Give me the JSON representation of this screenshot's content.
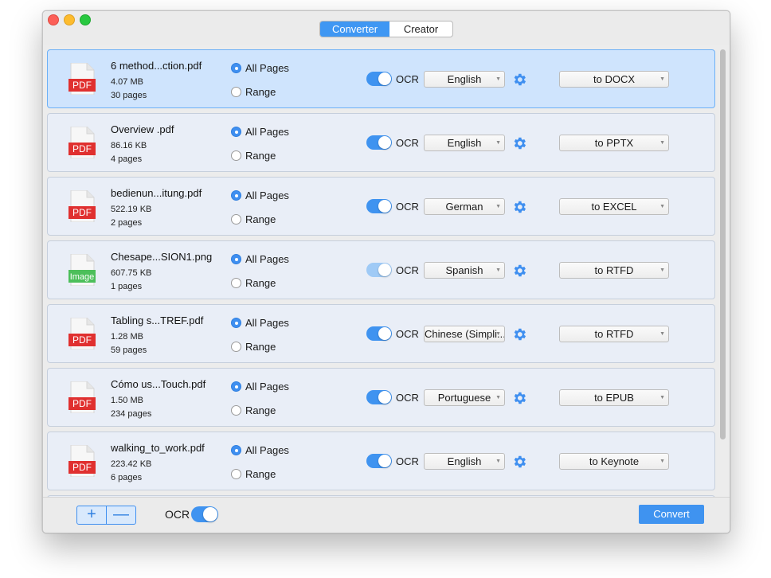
{
  "tabs": {
    "converter": "Converter",
    "creator": "Creator",
    "active": "Converter"
  },
  "files": [
    {
      "type": "PDF",
      "name": "6 method...ction.pdf",
      "size": "4.07 MB",
      "pages": "30 pages",
      "all_pages": "All Pages",
      "range": "Range",
      "ocr": "OCR",
      "ocr_on": true,
      "language": "English",
      "format": "to DOCX",
      "selected": true
    },
    {
      "type": "PDF",
      "name": "Overview .pdf",
      "size": "86.16 KB",
      "pages": "4 pages",
      "all_pages": "All Pages",
      "range": "Range",
      "ocr": "OCR",
      "ocr_on": true,
      "language": "English",
      "format": "to PPTX",
      "selected": false
    },
    {
      "type": "PDF",
      "name": "bedienun...itung.pdf",
      "size": "522.19 KB",
      "pages": "2 pages",
      "all_pages": "All Pages",
      "range": "Range",
      "ocr": "OCR",
      "ocr_on": true,
      "language": "German",
      "format": "to EXCEL",
      "selected": false
    },
    {
      "type": "Image",
      "name": "Chesape...SION1.png",
      "size": "607.75 KB",
      "pages": "1 pages",
      "all_pages": "All Pages",
      "range": "Range",
      "ocr": "OCR",
      "ocr_on": true,
      "language": "Spanish",
      "format": "to RTFD",
      "selected": false
    },
    {
      "type": "PDF",
      "name": "Tabling s...TREF.pdf",
      "size": "1.28 MB",
      "pages": "59 pages",
      "all_pages": "All Pages",
      "range": "Range",
      "ocr": "OCR",
      "ocr_on": true,
      "language": "Chinese (Simpli...",
      "format": "to RTFD",
      "selected": false
    },
    {
      "type": "PDF",
      "name": "Cómo us...Touch.pdf",
      "size": "1.50 MB",
      "pages": "234 pages",
      "all_pages": "All Pages",
      "range": "Range",
      "ocr": "OCR",
      "ocr_on": true,
      "language": "Portuguese",
      "format": "to EPUB",
      "selected": false
    },
    {
      "type": "PDF",
      "name": "walking_to_work.pdf",
      "size": "223.42 KB",
      "pages": "6 pages",
      "all_pages": "All Pages",
      "range": "Range",
      "ocr": "OCR",
      "ocr_on": true,
      "language": "English",
      "format": "to Keynote",
      "selected": false
    }
  ],
  "footer": {
    "add": "+",
    "remove": "—",
    "ocr_label": "OCR",
    "ocr_on": true,
    "convert": "Convert"
  },
  "colors": {
    "accent": "#3f93f0",
    "pdf_red": "#e0302f",
    "image_green": "#4cbf5a",
    "selected_row": "#cfe4fd"
  },
  "icons": {
    "gear": "gear-icon",
    "pdf": "pdf-file-icon",
    "image": "image-file-icon"
  }
}
